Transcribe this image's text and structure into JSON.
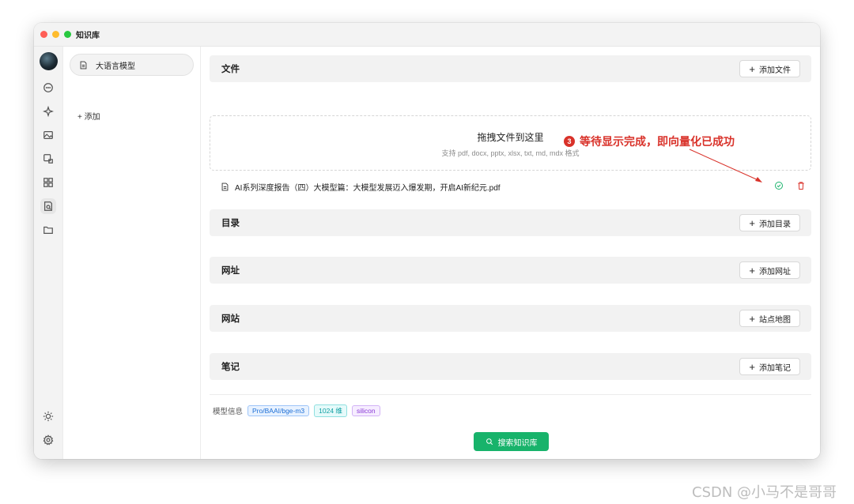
{
  "window": {
    "title": "知识库"
  },
  "rail": {
    "icons": [
      "avatar",
      "chat-icon",
      "sparkle-icon",
      "image-icon",
      "image-translate-icon",
      "apps-icon",
      "knowledge-icon",
      "folder-icon",
      "sun-icon",
      "settings-icon"
    ]
  },
  "kb_list": {
    "items": [
      {
        "label": "大语言模型"
      }
    ],
    "add_label": "+ 添加"
  },
  "sections": {
    "files": {
      "title": "文件",
      "button": "添加文件"
    },
    "directory": {
      "title": "目录",
      "button": "添加目录"
    },
    "url": {
      "title": "网址",
      "button": "添加网址"
    },
    "website": {
      "title": "网站",
      "button": "站点地图"
    },
    "notes": {
      "title": "笔记",
      "button": "添加笔记"
    }
  },
  "dropzone": {
    "title": "拖拽文件到这里",
    "subtitle": "支持 pdf, docx, pptx, xlsx, txt, md, mdx 格式"
  },
  "annotation": {
    "number": "3",
    "text": "等待显示完成，即向量化已成功",
    "color": "#d9322a"
  },
  "files": [
    {
      "name": "AI系列深度报告（四）大模型篇：大模型发展迈入爆发期，开启AI新纪元.pdf",
      "status": "done"
    }
  ],
  "model_info": {
    "label": "模型信息",
    "tags": [
      "Pro/BAAI/bge-m3",
      "1024 维",
      "silicon"
    ]
  },
  "search_button": "搜索知识库",
  "colors": {
    "accent_green": "#18b36b",
    "danger_red": "#d9322a"
  },
  "watermark": "CSDN @小马不是哥哥"
}
